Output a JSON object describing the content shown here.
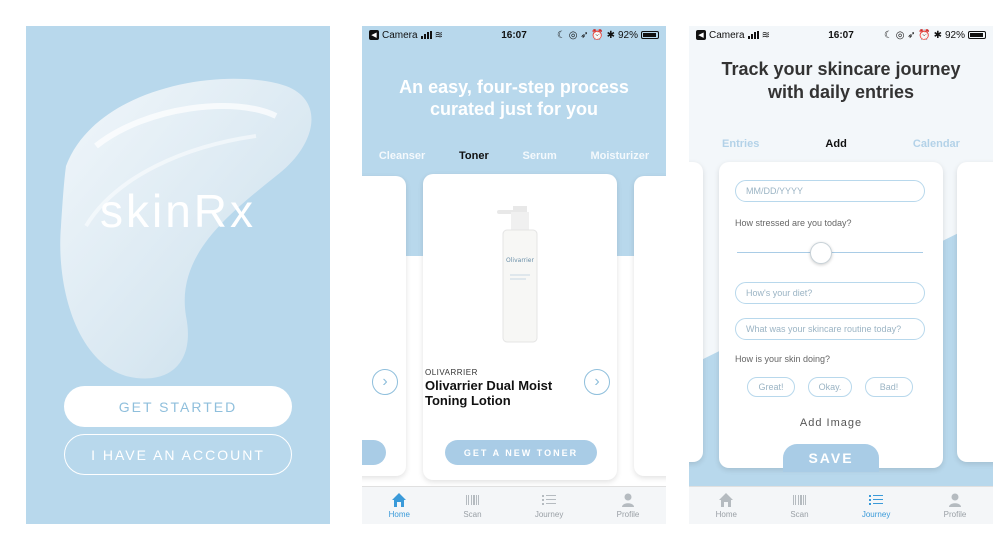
{
  "screen1": {
    "logo": "skinRx",
    "get_started": "GET STARTED",
    "have_account": "I HAVE AN ACCOUNT"
  },
  "status": {
    "carrier": "Camera",
    "time": "16:07",
    "battery": "92%"
  },
  "screen2": {
    "title_line1": "An easy, four-step process",
    "title_line2": "curated just for you",
    "tabs": [
      "Cleanser",
      "Toner",
      "Serum",
      "Moisturizer"
    ],
    "active_tab": "Toner",
    "product": {
      "brand": "OLIVARRIER",
      "name_line1": "Olivarrier Dual Moist",
      "name_line2": "Toning Lotion",
      "bottle_label": "Olivarrier"
    },
    "cta": "GET A NEW TONER"
  },
  "screen3": {
    "title_line1": "Track your skincare journey",
    "title_line2": "with daily entries",
    "tabs": [
      "Entries",
      "Add",
      "Calendar"
    ],
    "active_tab": "Add",
    "date_placeholder": "MM/DD/YYYY",
    "stress_label": "How stressed are you today?",
    "stress_level": 0.45,
    "diet_placeholder": "How's your diet?",
    "routine_placeholder": "What was your skincare routine today?",
    "skin_label": "How is your skin doing?",
    "choices": [
      "Great!",
      "Okay.",
      "Bad!"
    ],
    "add_image": "Add Image",
    "save": "SAVE"
  },
  "tabbar": {
    "items": [
      "Home",
      "Scan",
      "Journey",
      "Profile"
    ]
  },
  "colors": {
    "accent": "#b8d8ec",
    "active_tab": "#3a9ad9",
    "button": "#a9cce6"
  }
}
